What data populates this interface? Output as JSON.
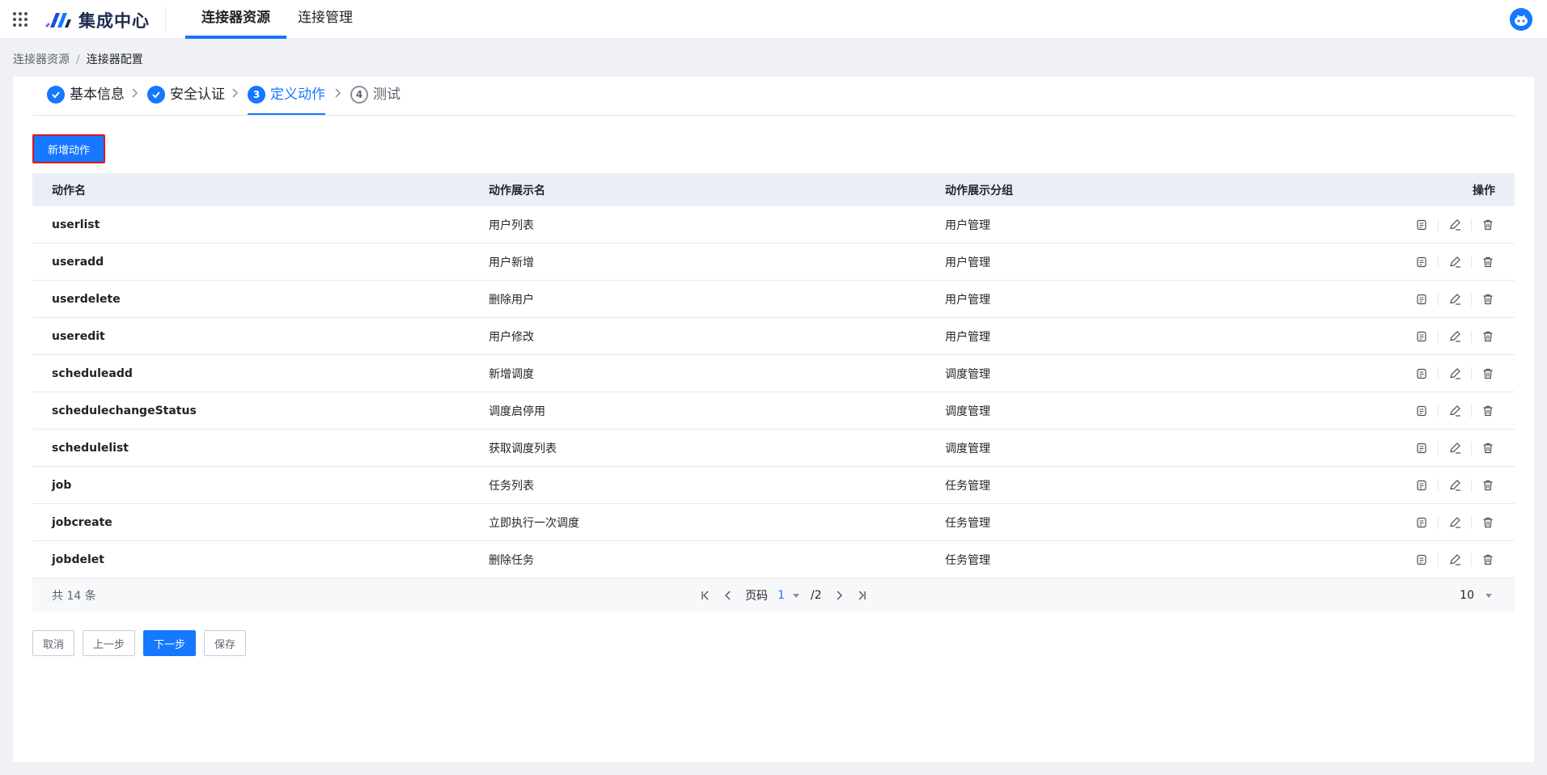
{
  "header": {
    "brand": "集成中心",
    "tabs": [
      {
        "label": "连接器资源",
        "active": true
      },
      {
        "label": "连接管理",
        "active": false
      }
    ],
    "accent_color": "#1677ff"
  },
  "breadcrumb": {
    "items": [
      "连接器资源",
      "连接器配置"
    ],
    "separator": "/"
  },
  "steps": [
    {
      "number": "1",
      "label": "基本信息",
      "state": "done"
    },
    {
      "number": "2",
      "label": "安全认证",
      "state": "done"
    },
    {
      "number": "3",
      "label": "定义动作",
      "state": "current"
    },
    {
      "number": "4",
      "label": "测试",
      "state": "todo"
    }
  ],
  "toolbar": {
    "add_label": "新增动作"
  },
  "table": {
    "columns": [
      "动作名",
      "动作展示名",
      "动作展示分组",
      "操作"
    ],
    "rows": [
      {
        "name": "userlist",
        "display": "用户列表",
        "group": "用户管理"
      },
      {
        "name": "useradd",
        "display": "用户新增",
        "group": "用户管理"
      },
      {
        "name": "userdelete",
        "display": "删除用户",
        "group": "用户管理"
      },
      {
        "name": "useredit",
        "display": "用户修改",
        "group": "用户管理"
      },
      {
        "name": "scheduleadd",
        "display": "新增调度",
        "group": "调度管理"
      },
      {
        "name": "schedulechangeStatus",
        "display": "调度启停用",
        "group": "调度管理"
      },
      {
        "name": "schedulelist",
        "display": "获取调度列表",
        "group": "调度管理"
      },
      {
        "name": "job",
        "display": "任务列表",
        "group": "任务管理"
      },
      {
        "name": "jobcreate",
        "display": "立即执行一次调度",
        "group": "任务管理"
      },
      {
        "name": "jobdelet",
        "display": "删除任务",
        "group": "任务管理"
      }
    ],
    "row_actions": [
      "detail-icon",
      "edit-icon",
      "delete-icon"
    ]
  },
  "pagination": {
    "total": "共 14 条",
    "page_label": "页码",
    "current_page": "1",
    "total_pages": "/2",
    "page_size": "10"
  },
  "footer": {
    "cancel_label": "取消",
    "prev_label": "上一步",
    "next_label": "下一步",
    "save_label": "保存"
  }
}
